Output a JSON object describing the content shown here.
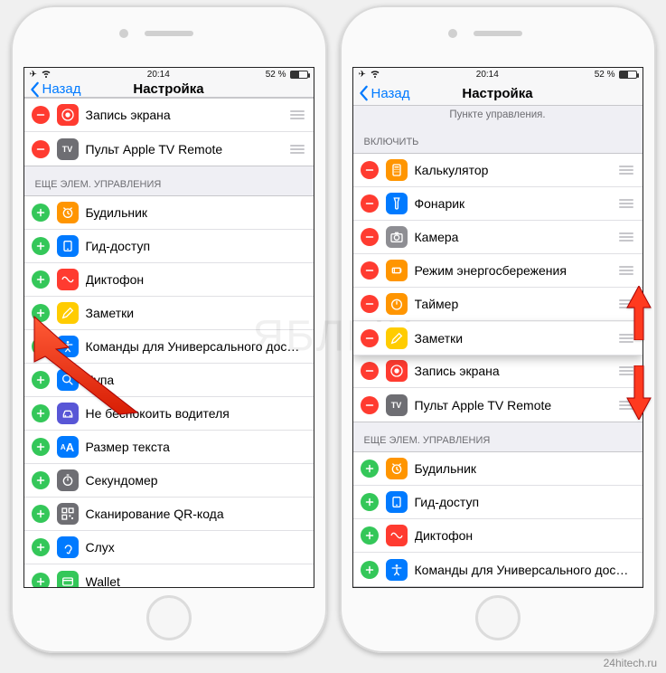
{
  "watermark": "ЯБЛЫК",
  "source_label": "24hitech.ru",
  "statusbar": {
    "time": "20:14",
    "battery": "52 %"
  },
  "nav": {
    "back": "Назад",
    "title": "Настройка"
  },
  "icon_colors": {
    "screen_record": "#ff3b30",
    "apple_tv": "#6e6e73",
    "alarm": "#ff9500",
    "guided": "#007aff",
    "voice_memo": "#ff3b30",
    "notes": "#ffcc00",
    "accessibility": "#007aff",
    "magnifier": "#007aff",
    "dnd_driving": "#5856d6",
    "text_size": "#007aff",
    "stopwatch": "#6e6e73",
    "qr": "#6e6e73",
    "hearing": "#007aff",
    "wallet": "#34c759",
    "calculator": "#ff9500",
    "flashlight": "#007aff",
    "camera_app": "#8e8e93",
    "low_power": "#ff9500",
    "timer": "#ff9500"
  },
  "phone_left": {
    "included": [
      {
        "icon": "screen_record",
        "label": "Запись экрана"
      },
      {
        "icon": "apple_tv",
        "label": "Пульт Apple TV Remote"
      }
    ],
    "more_header": "ЕЩЕ ЭЛЕМ. УПРАВЛЕНИЯ",
    "more": [
      {
        "icon": "alarm",
        "label": "Будильник"
      },
      {
        "icon": "guided",
        "label": "Гид-доступ"
      },
      {
        "icon": "voice_memo",
        "label": "Диктофон"
      },
      {
        "icon": "notes",
        "label": "Заметки"
      },
      {
        "icon": "accessibility",
        "label": "Команды для Универсального дост…"
      },
      {
        "icon": "magnifier",
        "label": "Лупа"
      },
      {
        "icon": "dnd_driving",
        "label": "Не беспокоить водителя"
      },
      {
        "icon": "text_size",
        "label": "Размер текста"
      },
      {
        "icon": "stopwatch",
        "label": "Секундомер"
      },
      {
        "icon": "qr",
        "label": "Сканирование QR-кода"
      },
      {
        "icon": "hearing",
        "label": "Слух"
      },
      {
        "icon": "wallet",
        "label": "Wallet"
      }
    ]
  },
  "phone_right": {
    "top_note": "Пункте управления.",
    "included_header": "ВКЛЮЧИТЬ",
    "included": [
      {
        "icon": "calculator",
        "label": "Калькулятор"
      },
      {
        "icon": "flashlight",
        "label": "Фонарик"
      },
      {
        "icon": "camera_app",
        "label": "Камера"
      },
      {
        "icon": "low_power",
        "label": "Режим энергосбережения"
      },
      {
        "icon": "timer",
        "label": "Таймер"
      },
      {
        "icon": "notes",
        "label": "Заметки",
        "dragging": true
      },
      {
        "icon": "screen_record",
        "label": "Запись экрана"
      },
      {
        "icon": "apple_tv",
        "label": "Пульт Apple TV Remote"
      }
    ],
    "more_header": "ЕЩЕ ЭЛЕМ. УПРАВЛЕНИЯ",
    "more": [
      {
        "icon": "alarm",
        "label": "Будильник"
      },
      {
        "icon": "guided",
        "label": "Гид-доступ"
      },
      {
        "icon": "voice_memo",
        "label": "Диктофон"
      },
      {
        "icon": "accessibility",
        "label": "Команды для Универсального дост…"
      }
    ]
  }
}
